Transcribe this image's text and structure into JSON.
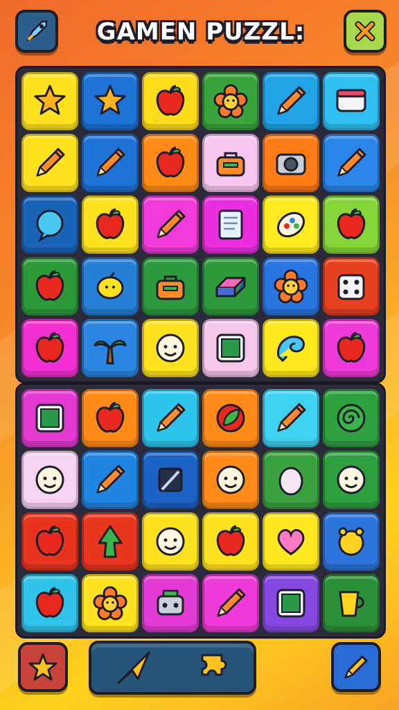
{
  "title": "GAMEN PUZZL:",
  "header": {
    "left_button_icon": "rocket-icon",
    "right_button_icon": "close-icon",
    "left_color": "#2c5f8a",
    "right_color": "#a7d84a"
  },
  "boards": [
    {
      "rows": [
        [
          "star",
          "star",
          "apple",
          "flower",
          "pencil",
          "box"
        ],
        [
          "pencil",
          "pencil",
          "apple",
          "bag",
          "camera",
          "pencil"
        ],
        [
          "bubble",
          "apple",
          "pencil",
          "note",
          "palette",
          "apple"
        ],
        [
          "apple",
          "lemon",
          "bag",
          "eraser",
          "flower",
          "dice"
        ],
        [
          "apple",
          "palm",
          "face",
          "card",
          "shell",
          "apple"
        ]
      ],
      "colors": [
        [
          "#ffe21f",
          "#1f72d6",
          "#ffdc1a",
          "#3aa53c",
          "#1fa3e6",
          "#2fbff0"
        ],
        [
          "#ffe21f",
          "#1f72d6",
          "#ff8a17",
          "#f7c7f0",
          "#ff7b16",
          "#2a86e8"
        ],
        [
          "#1a64b8",
          "#ffe21f",
          "#f13ad7",
          "#ea2ee0",
          "#ffea1f",
          "#86d63a"
        ],
        [
          "#2d9a3a",
          "#2580d6",
          "#2e9a40",
          "#2e9a3c",
          "#2b75e0",
          "#e84121"
        ],
        [
          "#f42fd2",
          "#2a86e0",
          "#ffe21f",
          "#f5c8ea",
          "#ffe81d",
          "#f03ad8"
        ]
      ]
    },
    {
      "rows": [
        [
          "card",
          "apple",
          "pencil",
          "leaf",
          "pencil",
          "swirl"
        ],
        [
          "face",
          "pencil",
          "pen",
          "face",
          "egg",
          "face"
        ],
        [
          "apple",
          "tree",
          "face",
          "apple",
          "heart",
          "bell"
        ],
        [
          "apple",
          "flower",
          "robot",
          "pencil",
          "card",
          "cup"
        ]
      ],
      "colors": [
        [
          "#e43ad2",
          "#ff8a17",
          "#2ec5ec",
          "#ff8a17",
          "#3fd1f0",
          "#2ea040"
        ],
        [
          "#f7d3f2",
          "#2085e0",
          "#1d63c6",
          "#ff8a17",
          "#3aa040",
          "#2ea040"
        ],
        [
          "#e8341f",
          "#e9361f",
          "#ffe21f",
          "#ffe21f",
          "#ffe81f",
          "#2d74dc"
        ],
        [
          "#2fc3ea",
          "#ffe21f",
          "#e43ad4",
          "#f03ad8",
          "#8648e0",
          "#2c8f3a"
        ]
      ]
    }
  ],
  "bottom": {
    "left_icon": "star-icon",
    "tray_icons": [
      "arrow-icon",
      "puzzle-icon"
    ],
    "right_icon": "pen-icon",
    "left_color": "#c8433a",
    "right_color": "#2a6cd6"
  }
}
